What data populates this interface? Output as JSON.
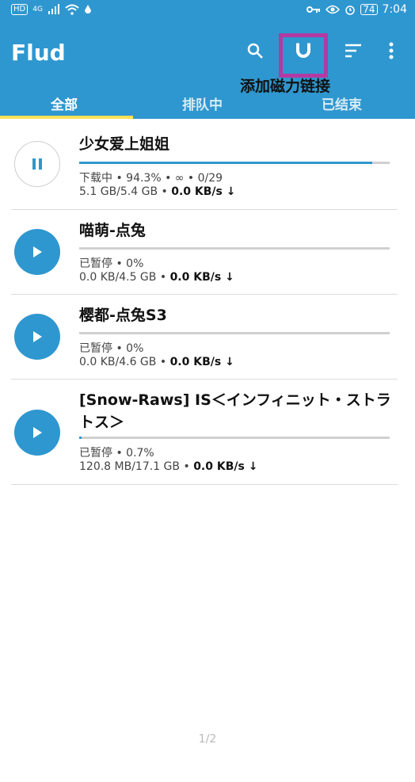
{
  "status_bar": {
    "left_icons": [
      "hd-icon",
      "signal-icon",
      "wifi-icon",
      "water-drop-icon"
    ],
    "hd_label": "HD",
    "net_label": "4G",
    "battery": "74",
    "time": "7:04"
  },
  "app_bar": {
    "title": "Flud",
    "tooltip": "添加磁力链接",
    "highlight_color": "#b23aa2",
    "accent_color": "#2f97cf"
  },
  "tabs": [
    {
      "label": "全部",
      "active": true
    },
    {
      "label": "排队中",
      "active": false
    },
    {
      "label": "已结束",
      "active": false
    }
  ],
  "torrents": [
    {
      "name": "少女爱上姐姐",
      "state": "paused",
      "status_line": "下载中 • 94.3% • ∞ • 0/29",
      "size": "5.1 GB/5.4 GB",
      "speed": "0.0 KB/s ↓",
      "progress": 0.943
    },
    {
      "name": "喵萌-点兔",
      "state": "stopped",
      "status_line": "已暂停 • 0%",
      "size": "0.0 KB/4.5 GB",
      "speed": "0.0 KB/s ↓",
      "progress": 0.0
    },
    {
      "name": "樱都-点兔S3",
      "state": "stopped",
      "status_line": "已暂停 • 0%",
      "size": "0.0 KB/4.6 GB",
      "speed": "0.0 KB/s ↓",
      "progress": 0.0
    },
    {
      "name": "[Snow-Raws] IS＜インフィニット・ストラトス＞",
      "state": "stopped",
      "status_line": "已暂停 • 0.7%",
      "size": "120.8 MB/17.1 GB",
      "speed": "0.0 KB/s ↓",
      "progress": 0.007
    }
  ],
  "pager": "1/2"
}
